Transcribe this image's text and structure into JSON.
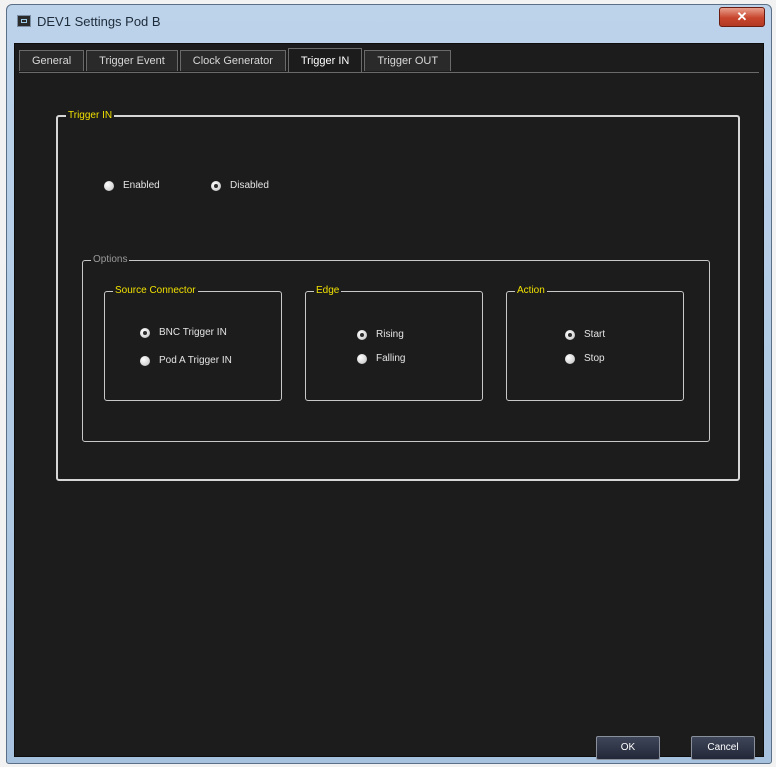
{
  "window": {
    "title": "DEV1 Settings Pod B",
    "close_label": "✕"
  },
  "tabs": [
    {
      "label": "General"
    },
    {
      "label": "Trigger Event"
    },
    {
      "label": "Clock Generator"
    },
    {
      "label": "Trigger IN",
      "active": true
    },
    {
      "label": "Trigger OUT"
    }
  ],
  "trigger_in": {
    "title": "Trigger IN",
    "enabled_label": "Enabled",
    "disabled_label": "Disabled",
    "selected": "Disabled"
  },
  "options": {
    "title": "Options",
    "source_connector": {
      "title": "Source Connector",
      "items": [
        {
          "label": "BNC Trigger IN",
          "checked": true
        },
        {
          "label": "Pod A Trigger IN",
          "checked": false
        }
      ]
    },
    "edge": {
      "title": "Edge",
      "items": [
        {
          "label": "Rising",
          "checked": true
        },
        {
          "label": "Falling",
          "checked": false
        }
      ]
    },
    "action": {
      "title": "Action",
      "items": [
        {
          "label": "Start",
          "checked": true
        },
        {
          "label": "Stop",
          "checked": false
        }
      ]
    }
  },
  "buttons": {
    "ok_label": "OK",
    "cancel_label": "Cancel"
  },
  "colors": {
    "background": "#1c1c1c",
    "group_title": "#f0e000",
    "border": "#d6d6d6",
    "button": "#2b3142"
  }
}
